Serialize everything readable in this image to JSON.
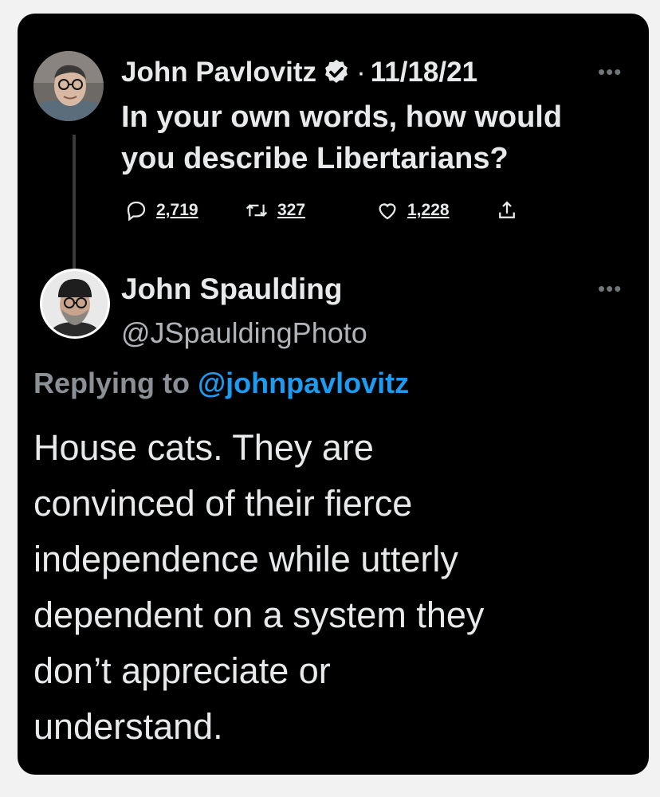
{
  "original_tweet": {
    "author_name": "John Pavlovitz",
    "date_separator": "·",
    "date": "11/18/21",
    "more_icon": "more-dots-icon",
    "text_lines": [
      "In your own words, how would",
      "you describe Libertarians?"
    ],
    "actions": {
      "replies": "2,719",
      "retweets": "327",
      "likes": "1,228"
    },
    "verified_color": "#e7e9ea"
  },
  "reply_tweet": {
    "author_name": "John Spaulding",
    "handle": "@JSpauldingPhoto",
    "replying_label": "Replying to",
    "replying_mention": "@johnpavlovitz",
    "text_lines": [
      "House cats. They are",
      "convinced of their fierce",
      "independence while utterly",
      "dependent on a system they",
      "don’t appreciate or",
      "understand."
    ]
  },
  "colors": {
    "background": "#000000",
    "text": "#e7e9ea",
    "muted": "#71767b",
    "link": "#1d9bf0"
  }
}
